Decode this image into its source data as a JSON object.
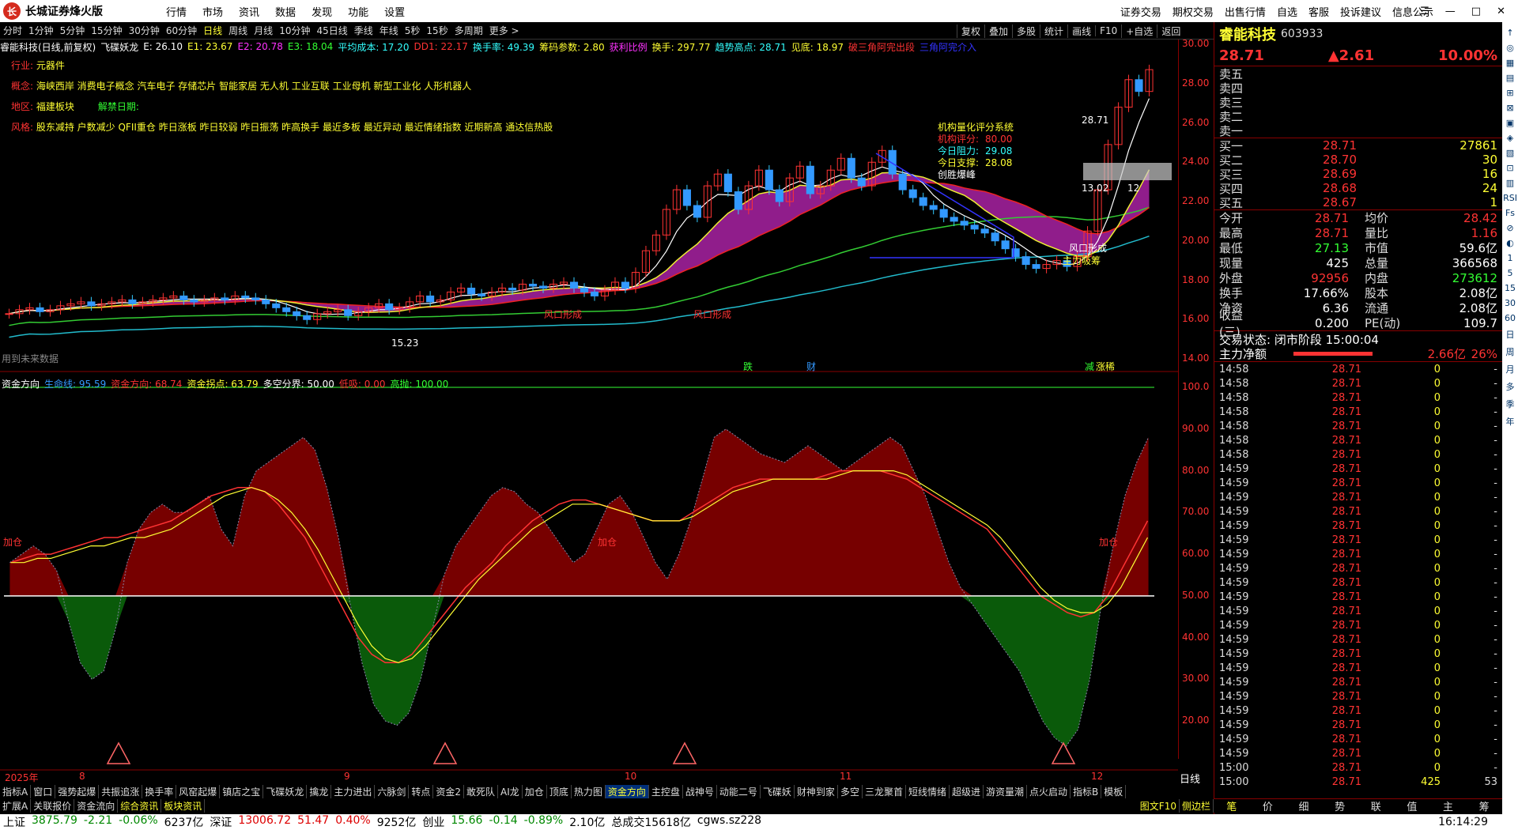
{
  "app": {
    "name": "长城证券烽火版",
    "logo_text": "长"
  },
  "menu": [
    "行情",
    "市场",
    "资讯",
    "数据",
    "发现",
    "功能",
    "设置"
  ],
  "right_menu": [
    "证券交易",
    "期权交易",
    "出售行情",
    "自选",
    "客服",
    "投诉建议",
    "信息公示"
  ],
  "window_buttons": [
    "☰",
    "—",
    "□",
    "✕"
  ],
  "periods": [
    "分时",
    "1分钟",
    "5分钟",
    "15分钟",
    "30分钟",
    "60分钟",
    "日线",
    "周线",
    "月线",
    "10分钟",
    "45日线",
    "季线",
    "年线",
    "5秒",
    "15秒",
    "多周期",
    "更多 >"
  ],
  "active_period": "日线",
  "top_tools": [
    "复权",
    "叠加",
    "多股",
    "统计",
    "画线",
    "F10",
    "+自选",
    "返回"
  ],
  "kline_header": {
    "stock": "睿能科技(日线,前复权)",
    "indicator": "飞碟妖龙",
    "items": [
      {
        "text": "E: 26.10",
        "color": "#fff"
      },
      {
        "text": "E1: 23.67",
        "color": "#ff3"
      },
      {
        "text": "E2: 20.78",
        "color": "#f3f"
      },
      {
        "text": "E3: 18.04",
        "color": "#3f3"
      },
      {
        "text": "平均成本: 17.20",
        "color": "#3ff"
      },
      {
        "text": "DD1: 22.17",
        "color": "#f33"
      },
      {
        "text": "换手率: 49.39",
        "color": "#3ff"
      },
      {
        "text": "筹码参数: 2.80",
        "color": "#ff3"
      },
      {
        "text": "获利比例",
        "color": "#f3f"
      },
      {
        "text": "换手: 297.77",
        "color": "#ff3"
      },
      {
        "text": "趋势高点: 28.71",
        "color": "#3ff"
      },
      {
        "text": "见底: 18.97",
        "color": "#ff3"
      },
      {
        "text": "破三角阿完出段",
        "color": "#f33"
      },
      {
        "text": "三角阿完介入",
        "color": "#33f"
      }
    ]
  },
  "info_lines": [
    {
      "label": "行业: ",
      "value": "元器件"
    },
    {
      "label": "概念: ",
      "value": "海峡西岸 消费电子概念 汽车电子 存储芯片 智能家居 无人机 工业互联 工业母机 新型工业化 人形机器人"
    },
    {
      "label": "地区: ",
      "value": "福建板块",
      "extra": "解禁日期:"
    },
    {
      "label": "风格: ",
      "value": "股东减持 户数减少 QFII重仓 昨日涨板 昨日较弱 昨日振荡 昨高换手 最近多板 最近异动 最近情绪指数 近期新高 通达信热股"
    }
  ],
  "scoring": {
    "title": "机构量化评分系统",
    "rows": [
      {
        "k": "机构评分:",
        "v": "80.00"
      },
      {
        "k": "今日阻力:",
        "v": "29.08"
      },
      {
        "k": "今日支撑:",
        "v": "28.08"
      }
    ],
    "note": "创胜爆峰"
  },
  "chart_labels": {
    "low_price": "15.23",
    "high_price": "28.71",
    "mid_price": "13.02",
    "mid_vol": "12",
    "fengkou1": "风口形成",
    "fengkou2": "风口形成",
    "fengkou3": "风口形成",
    "zhuli": "主力吸筹",
    "future": "用到未来数据",
    "die": "跌",
    "cai": "财",
    "jian": "减",
    "zhang": "涨稀"
  },
  "y_ticks_main": [
    "30.00",
    "28.00",
    "26.00",
    "24.00",
    "22.00",
    "20.00",
    "18.00",
    "16.00",
    "14.00"
  ],
  "y_ticks_sub": [
    "100.0",
    "90.00",
    "80.00",
    "70.00",
    "60.00",
    "50.00",
    "40.00",
    "30.00",
    "20.00"
  ],
  "sub_header": {
    "name": "资金方向",
    "items": [
      {
        "text": "生命线: 95.59",
        "color": "#39f"
      },
      {
        "text": "资金方向: 68.74",
        "color": "#f33"
      },
      {
        "text": "资金拐点: 63.79",
        "color": "#ff3"
      },
      {
        "text": "多空分界: 50.00",
        "color": "#fff"
      },
      {
        "text": "低吸: 0.00",
        "color": "#f33"
      },
      {
        "text": "高抛: 100.00",
        "color": "#3f3"
      }
    ],
    "labels": [
      "加仓",
      "加仓",
      "加仓"
    ]
  },
  "date_axis": [
    "2025年",
    "8",
    "9",
    "10",
    "11",
    "12"
  ],
  "date_mode": "日线",
  "tabs_row1": [
    "指标A",
    "窗口",
    "强势起爆",
    "共振追涨",
    "换手率",
    "风窑起爆",
    "镇店之宝",
    "飞碟妖龙",
    "擒龙",
    "主力进出",
    "六脉剑",
    "转点",
    "资金2",
    "敢死队",
    "AI龙",
    "加仓",
    "顶底",
    "热力图",
    "资金方向",
    "主控盘",
    "战神号",
    "动能二号",
    "飞碟妖",
    "财神到家",
    "多空",
    "三龙聚首",
    "短线情绪",
    "超级进",
    "游资量潮",
    "点火启动",
    "指标B",
    "模板"
  ],
  "active_tab": "资金方向",
  "tabs_row2": [
    "扩展A",
    "关联报价",
    "资金流向",
    "综合资讯",
    "板块资讯"
  ],
  "tabs_row2_extra": [
    "图文F10",
    "侧边栏"
  ],
  "quote": {
    "name": "睿能科技",
    "code": "603933",
    "price": "28.71",
    "change": "▲2.61",
    "pct": "10.00%",
    "asks": [
      {
        "k": "卖五",
        "p": "",
        "v": ""
      },
      {
        "k": "卖四",
        "p": "",
        "v": ""
      },
      {
        "k": "卖三",
        "p": "",
        "v": ""
      },
      {
        "k": "卖二",
        "p": "",
        "v": ""
      },
      {
        "k": "卖一",
        "p": "",
        "v": ""
      }
    ],
    "bids": [
      {
        "k": "买一",
        "p": "28.71",
        "v": "27861"
      },
      {
        "k": "买二",
        "p": "28.70",
        "v": "30"
      },
      {
        "k": "买三",
        "p": "28.69",
        "v": "16"
      },
      {
        "k": "买四",
        "p": "28.68",
        "v": "24"
      },
      {
        "k": "买五",
        "p": "28.67",
        "v": "1"
      }
    ],
    "stats": [
      {
        "a": "今开",
        "b": "28.71",
        "c": "均价",
        "d": "28.42"
      },
      {
        "a": "最高",
        "b": "28.71",
        "c": "量比",
        "d": "1.16"
      },
      {
        "a": "最低",
        "b": "27.13",
        "c": "市值",
        "d": "59.6亿"
      },
      {
        "a": "现量",
        "b": "425",
        "c": "总量",
        "d": "366568"
      },
      {
        "a": "外盘",
        "b": "92956",
        "c": "内盘",
        "d": "273612"
      },
      {
        "a": "换手",
        "b": "17.66%",
        "c": "股本",
        "d": "2.08亿"
      },
      {
        "a": "净资",
        "b": "6.36",
        "c": "流通",
        "d": "2.08亿"
      },
      {
        "a": "收益(三)",
        "b": "0.200",
        "c": "PE(动)",
        "d": "109.7"
      }
    ],
    "trade_state": "交易状态: 闭市阶段 15:00:04",
    "net_label": "主力净额",
    "net_value": "2.66亿",
    "net_pct": "26%",
    "ticks": [
      {
        "t": "14:58",
        "p": "28.71",
        "v": "0",
        "z": "-"
      },
      {
        "t": "14:58",
        "p": "28.71",
        "v": "0",
        "z": "-"
      },
      {
        "t": "14:58",
        "p": "28.71",
        "v": "0",
        "z": "-"
      },
      {
        "t": "14:58",
        "p": "28.71",
        "v": "0",
        "z": "-"
      },
      {
        "t": "14:58",
        "p": "28.71",
        "v": "0",
        "z": "-"
      },
      {
        "t": "14:58",
        "p": "28.71",
        "v": "0",
        "z": "-"
      },
      {
        "t": "14:58",
        "p": "28.71",
        "v": "0",
        "z": "-"
      },
      {
        "t": "14:59",
        "p": "28.71",
        "v": "0",
        "z": "-"
      },
      {
        "t": "14:59",
        "p": "28.71",
        "v": "0",
        "z": "-"
      },
      {
        "t": "14:59",
        "p": "28.71",
        "v": "0",
        "z": "-"
      },
      {
        "t": "14:59",
        "p": "28.71",
        "v": "0",
        "z": "-"
      },
      {
        "t": "14:59",
        "p": "28.71",
        "v": "0",
        "z": "-"
      },
      {
        "t": "14:59",
        "p": "28.71",
        "v": "0",
        "z": "-"
      },
      {
        "t": "14:59",
        "p": "28.71",
        "v": "0",
        "z": "-"
      },
      {
        "t": "14:59",
        "p": "28.71",
        "v": "0",
        "z": "-"
      },
      {
        "t": "14:59",
        "p": "28.71",
        "v": "0",
        "z": "-"
      },
      {
        "t": "14:59",
        "p": "28.71",
        "v": "0",
        "z": "-"
      },
      {
        "t": "14:59",
        "p": "28.71",
        "v": "0",
        "z": "-"
      },
      {
        "t": "14:59",
        "p": "28.71",
        "v": "0",
        "z": "-"
      },
      {
        "t": "14:59",
        "p": "28.71",
        "v": "0",
        "z": "-"
      },
      {
        "t": "14:59",
        "p": "28.71",
        "v": "0",
        "z": "-"
      },
      {
        "t": "14:59",
        "p": "28.71",
        "v": "0",
        "z": "-"
      },
      {
        "t": "14:59",
        "p": "28.71",
        "v": "0",
        "z": "-"
      },
      {
        "t": "14:59",
        "p": "28.71",
        "v": "0",
        "z": "-"
      },
      {
        "t": "14:59",
        "p": "28.71",
        "v": "0",
        "z": "-"
      },
      {
        "t": "14:59",
        "p": "28.71",
        "v": "0",
        "z": "-"
      },
      {
        "t": "14:59",
        "p": "28.71",
        "v": "0",
        "z": "-"
      },
      {
        "t": "14:59",
        "p": "28.71",
        "v": "0",
        "z": "-"
      },
      {
        "t": "15:00",
        "p": "28.71",
        "v": "0",
        "z": "-"
      },
      {
        "t": "15:00",
        "p": "28.71",
        "v": "425",
        "z": "53"
      }
    ],
    "tabs": [
      "笔",
      "价",
      "细",
      "势",
      "联",
      "值",
      "主",
      "筹"
    ]
  },
  "side_strip": [
    "↑",
    "◎",
    "▦",
    "▤",
    "⊞",
    "⊠",
    "▣",
    "◈",
    "▧",
    "⊡",
    "▥",
    "RSI",
    "Fs",
    "⊘",
    "◐",
    "1",
    "5",
    "15",
    "30",
    "60",
    "日",
    "周",
    "月",
    "多",
    "季",
    "年"
  ],
  "status": [
    {
      "text": "上证",
      "color": "#000"
    },
    {
      "text": "3875.79",
      "color": "#080"
    },
    {
      "text": "-2.21",
      "color": "#080"
    },
    {
      "text": "-0.06%",
      "color": "#080"
    },
    {
      "text": "6237亿",
      "color": "#000"
    },
    {
      "text": "深证",
      "color": "#000"
    },
    {
      "text": "13006.72",
      "color": "#d00"
    },
    {
      "text": "51.47",
      "color": "#d00"
    },
    {
      "text": "0.40%",
      "color": "#d00"
    },
    {
      "text": "9252亿",
      "color": "#000"
    },
    {
      "text": "创业",
      "color": "#000"
    },
    {
      "text": "15.66",
      "color": "#080"
    },
    {
      "text": "-0.14",
      "color": "#080"
    },
    {
      "text": "-0.89%",
      "color": "#080"
    },
    {
      "text": "2.10亿",
      "color": "#000"
    },
    {
      "text": "总成交15618亿",
      "color": "#000"
    },
    {
      "text": "cgws.sz228",
      "color": "#000"
    }
  ],
  "clock": "16:14:29",
  "chart_data": {
    "type": "line",
    "title": "睿能科技(日线,前复权)",
    "main": {
      "ylim": [
        14,
        30
      ],
      "close": [
        16.3,
        16.5,
        16.6,
        16.4,
        16.5,
        16.7,
        16.8,
        16.9,
        16.7,
        16.8,
        16.9,
        17.0,
        16.8,
        16.9,
        17.0,
        17.1,
        17.2,
        17.0,
        16.9,
        17.0,
        17.1,
        17.0,
        17.2,
        17.1,
        17.0,
        16.8,
        16.6,
        16.4,
        16.2,
        16.0,
        16.3,
        16.4,
        16.5,
        16.2,
        16.4,
        16.6,
        16.8,
        16.5,
        16.6,
        16.9,
        17.2,
        16.9,
        17.0,
        17.4,
        17.6,
        17.3,
        17.2,
        17.4,
        17.6,
        17.5,
        17.8,
        17.7,
        17.6,
        17.8,
        17.9,
        17.6,
        17.4,
        17.2,
        17.5,
        17.9,
        17.6,
        18.4,
        19.5,
        20.3,
        21.6,
        22.6,
        21.8,
        21.2,
        22.8,
        23.4,
        22.5,
        21.6,
        22.8,
        23.6,
        22.6,
        22.0,
        23.2,
        23.8,
        22.4,
        22.8,
        23.6,
        24.2,
        23.2,
        22.8,
        24.0,
        24.6,
        23.4,
        22.6,
        22.2,
        21.8,
        21.6,
        21.2,
        21.0,
        20.8,
        20.6,
        20.4,
        20.0,
        19.6,
        19.2,
        18.8,
        18.6,
        18.8,
        19.0,
        18.7,
        19.2,
        20.5,
        22.6,
        24.9,
        26.8,
        28.2,
        27.6,
        28.71
      ],
      "x_labels": [
        "2025年",
        "8",
        "9",
        "10",
        "11",
        "12"
      ],
      "y_ticks": [
        30,
        28,
        26,
        24,
        22,
        20,
        18,
        16,
        14
      ]
    },
    "sub": {
      "name": "资金方向",
      "ylim": [
        10,
        100
      ],
      "y_ticks": [
        100,
        90,
        80,
        70,
        60,
        50,
        40,
        30,
        20
      ],
      "series": [
        {
          "name": "生命线",
          "values": [
            58,
            60,
            62,
            60,
            56,
            44,
            34,
            30,
            32,
            42,
            58,
            66,
            70,
            72,
            70,
            70,
            72,
            74,
            66,
            62,
            74,
            80,
            82,
            84,
            86,
            88,
            85,
            76,
            64,
            48,
            34,
            24,
            20,
            19,
            22,
            30,
            42,
            55,
            62,
            66,
            70,
            74,
            76,
            75,
            72,
            70,
            66,
            62,
            58,
            60,
            66,
            72,
            74,
            70,
            64,
            58,
            54,
            60,
            68,
            78,
            88,
            90,
            88,
            86,
            84,
            83,
            82,
            84,
            86,
            84,
            82,
            80,
            82,
            84,
            86,
            88,
            86,
            80,
            74,
            66,
            58,
            52,
            48,
            44,
            40,
            36,
            32,
            26,
            20,
            16,
            14,
            18,
            30,
            48,
            62,
            74,
            82,
            88
          ]
        },
        {
          "name": "资金方向",
          "values": [
            58,
            59,
            60,
            60,
            61,
            62,
            63,
            64,
            64,
            65,
            66,
            67,
            68,
            70,
            72,
            74,
            75,
            76,
            76,
            75,
            72,
            68,
            64,
            58,
            52,
            46,
            40,
            36,
            34,
            34,
            36,
            40,
            44,
            48,
            52,
            55,
            58,
            62,
            65,
            68,
            70,
            72,
            73,
            73,
            72,
            71,
            70,
            69,
            68,
            68,
            68,
            70,
            72,
            74,
            76,
            77,
            78,
            78,
            78,
            78,
            78,
            79,
            80,
            80,
            80,
            80,
            79,
            78,
            76,
            74,
            72,
            70,
            68,
            66,
            62,
            58,
            54,
            50,
            48,
            46,
            45,
            46,
            50,
            56,
            62,
            68
          ]
        },
        {
          "name": "资金拐点",
          "values": [
            58,
            58,
            59,
            59,
            60,
            61,
            62,
            62,
            63,
            64,
            64,
            65,
            66,
            68,
            70,
            72,
            74,
            75,
            76,
            75,
            73,
            70,
            66,
            61,
            55,
            49,
            43,
            38,
            35,
            34,
            35,
            38,
            42,
            46,
            50,
            54,
            57,
            60,
            63,
            66,
            68,
            70,
            72,
            72,
            72,
            71,
            70,
            69,
            68,
            68,
            68,
            69,
            71,
            73,
            75,
            76,
            77,
            78,
            78,
            78,
            78,
            78,
            79,
            80,
            80,
            80,
            80,
            79,
            77,
            75,
            73,
            71,
            69,
            67,
            64,
            60,
            56,
            52,
            49,
            47,
            46,
            46,
            48,
            52,
            58,
            64
          ]
        }
      ],
      "lines": [
        {
          "name": "多空分界",
          "value": 50
        },
        {
          "name": "高抛",
          "value": 100
        }
      ]
    }
  }
}
